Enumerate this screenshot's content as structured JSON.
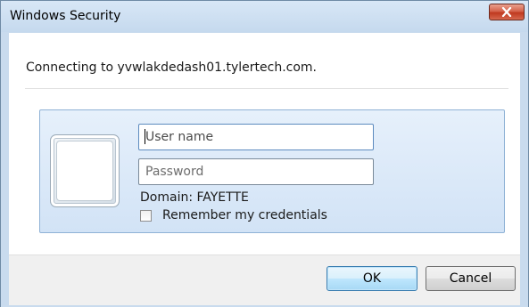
{
  "window": {
    "title": "Windows Security"
  },
  "message": {
    "connecting": "Connecting to yvwlakdedash01.tylertech.com."
  },
  "credentials": {
    "username_placeholder": "User name",
    "password_placeholder": "Password",
    "domain_text": "Domain: FAYETTE",
    "remember_label": "Remember my credentials",
    "remember_checked": false
  },
  "buttons": {
    "ok_label": "OK",
    "cancel_label": "Cancel"
  },
  "colors": {
    "close_button": "#c9452b",
    "panel_border": "#8fb2d6",
    "default_button_border": "#3c7fb1"
  },
  "icons": {
    "close": "close-icon",
    "user_tile": "user-tile-icon"
  }
}
